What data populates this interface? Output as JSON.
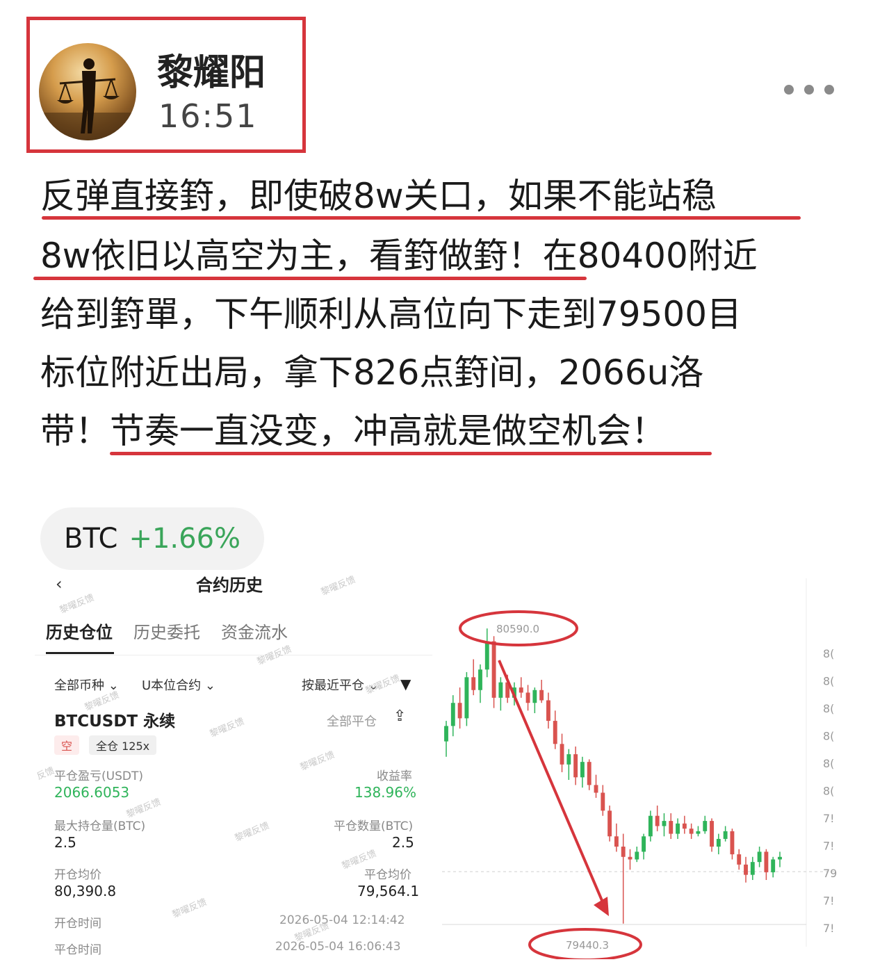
{
  "post": {
    "author": "黎耀阳",
    "time": "16:51",
    "more_icon": "more-horizontal-icon",
    "lines": [
      "反弹直接篈，即使破8w关口，如果不能站稳",
      "8w依旧以高空为主，看篈做篈！在80400附近",
      "给到篈單，下午顺利从高位向下走到79500目",
      "标位附近出局，拿下826点篈间，2066u洛",
      "带！节奏一直没变，冲高就是做空机会！"
    ]
  },
  "stock_tag": {
    "symbol": "BTC",
    "change": "+1.66%"
  },
  "screenshot": {
    "back_icon": "back-chevron-icon",
    "title": "合约历史",
    "tabs": [
      "历史仓位",
      "历史委托",
      "资金流水"
    ],
    "filters": {
      "coin": "全部币种",
      "contract": "U本位合约",
      "sort": "按最近平仓"
    },
    "filter_icon": "filter-funnel-icon",
    "pair": "BTCUSDT 永续",
    "close_all": "全部平仓",
    "share_icon": "share-icon",
    "badges": {
      "side": "空",
      "margin": "全仓 125x"
    },
    "pnl_label": "平仓盈亏(USDT)",
    "pnl_value": "2066.6053",
    "roi_label": "收益率",
    "roi_value": "138.96%",
    "max_pos_label": "最大持仓量(BTC)",
    "max_pos_value": "2.5",
    "close_qty_label": "平仓数量(BTC)",
    "close_qty_value": "2.5",
    "open_avg_label": "开仓均价",
    "open_avg_value": "80,390.8",
    "close_avg_label": "平仓均价",
    "close_avg_value": "79,564.1",
    "open_time_label": "开仓时间",
    "open_time_value": "2026-05-04 12:14:42",
    "close_time_label": "平仓时间",
    "close_time_value": "2026-05-04 16:06:43",
    "watermark": "黎曜反馈",
    "partial_watermark": "反馈"
  },
  "chart_data": {
    "type": "candlestick",
    "high_label": "80590.0",
    "low_label": "79440.3",
    "ylim": [
      79350,
      80650
    ],
    "axis_tick_fragments": [
      "8(",
      "8(",
      "8(",
      "8(",
      "8(",
      "8(",
      "7!",
      "7!",
      "79",
      "7!",
      "7!"
    ],
    "colors": {
      "up": "#2fb45a",
      "down": "#d9534f",
      "annotation": "#d6353c"
    },
    "candles": [
      [
        80150,
        80230,
        80090,
        80210
      ],
      [
        80210,
        80330,
        80170,
        80300
      ],
      [
        80300,
        80360,
        80200,
        80240
      ],
      [
        80240,
        80420,
        80210,
        80400
      ],
      [
        80400,
        80470,
        80330,
        80350
      ],
      [
        80350,
        80450,
        80300,
        80430
      ],
      [
        80430,
        80590,
        80400,
        80540
      ],
      [
        80540,
        80560,
        80280,
        80320
      ],
      [
        80320,
        80400,
        80270,
        80380
      ],
      [
        80380,
        80410,
        80300,
        80320
      ],
      [
        80320,
        80380,
        80290,
        80360
      ],
      [
        80360,
        80400,
        80320,
        80340
      ],
      [
        80340,
        80370,
        80270,
        80300
      ],
      [
        80300,
        80360,
        80260,
        80350
      ],
      [
        80350,
        80390,
        80300,
        80310
      ],
      [
        80310,
        80340,
        80200,
        80230
      ],
      [
        80230,
        80270,
        80120,
        80140
      ],
      [
        80140,
        80180,
        80030,
        80060
      ],
      [
        80060,
        80120,
        80000,
        80100
      ],
      [
        80100,
        80130,
        79980,
        80010
      ],
      [
        80010,
        80090,
        79970,
        80070
      ],
      [
        80070,
        80080,
        79960,
        79980
      ],
      [
        79980,
        80020,
        79930,
        79950
      ],
      [
        79950,
        79980,
        79860,
        79880
      ],
      [
        79880,
        79900,
        79760,
        79780
      ],
      [
        79780,
        79830,
        79720,
        79740
      ],
      [
        79740,
        79790,
        79440,
        79700
      ],
      [
        79700,
        79730,
        79650,
        79690
      ],
      [
        79690,
        79740,
        79680,
        79720
      ],
      [
        79720,
        79790,
        79690,
        79780
      ],
      [
        79780,
        79880,
        79760,
        79860
      ],
      [
        79860,
        79900,
        79800,
        79820
      ],
      [
        79820,
        79870,
        79780,
        79840
      ],
      [
        79840,
        79870,
        79770,
        79790
      ],
      [
        79790,
        79850,
        79770,
        79830
      ],
      [
        79830,
        79860,
        79790,
        79810
      ],
      [
        79810,
        79830,
        79770,
        79790
      ],
      [
        79790,
        79820,
        79780,
        79800
      ],
      [
        79800,
        79860,
        79790,
        79840
      ],
      [
        79840,
        79850,
        79720,
        79740
      ],
      [
        79740,
        79790,
        79710,
        79770
      ],
      [
        79770,
        79820,
        79760,
        79800
      ],
      [
        79800,
        79810,
        79690,
        79710
      ],
      [
        79710,
        79730,
        79650,
        79670
      ],
      [
        79670,
        79700,
        79600,
        79630
      ],
      [
        79630,
        79700,
        79610,
        79680
      ],
      [
        79680,
        79740,
        79660,
        79720
      ],
      [
        79720,
        79730,
        79610,
        79640
      ],
      [
        79640,
        79700,
        79620,
        79690
      ],
      [
        79690,
        79720,
        79660,
        79700
      ]
    ]
  }
}
